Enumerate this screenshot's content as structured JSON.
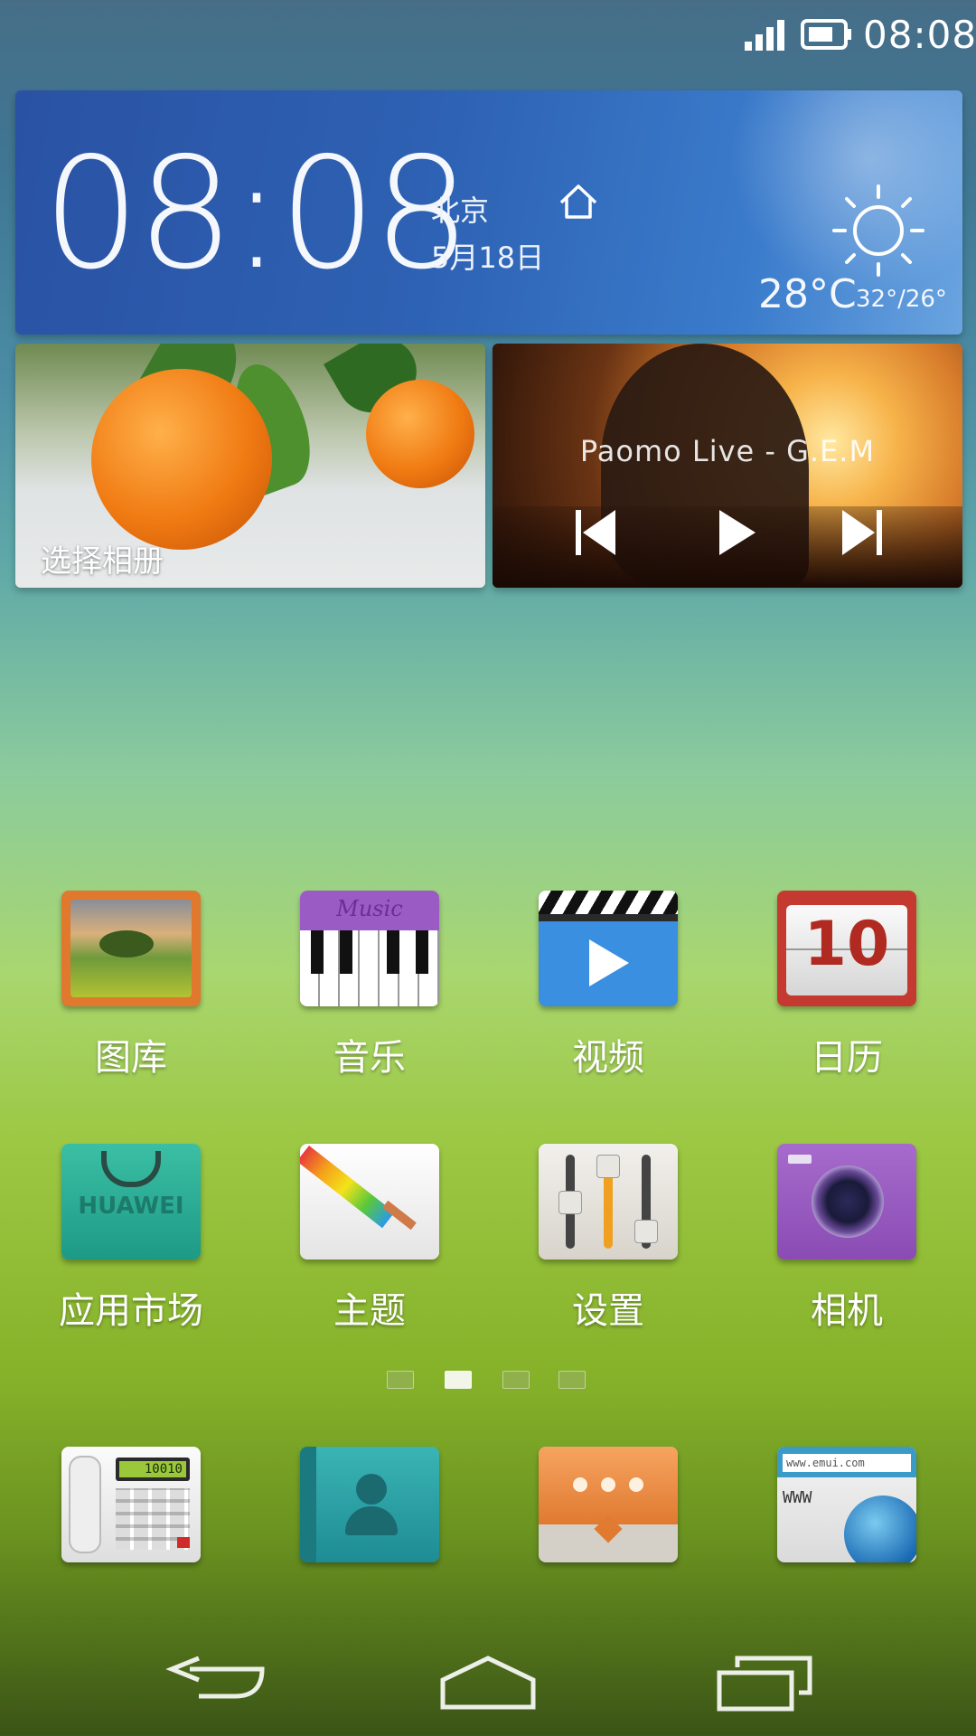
{
  "status_bar": {
    "time": "08:08"
  },
  "clock_widget": {
    "time": "08:08",
    "city": "北京",
    "date": "5月18日",
    "temperature": "28°C",
    "range": "32°/26°",
    "weather_icon": "sun-icon"
  },
  "photo_widget": {
    "label": "选择相册"
  },
  "music_widget": {
    "title": "Paomo Live - G.E.M"
  },
  "apps": [
    {
      "label": "图库",
      "icon": "gallery-icon"
    },
    {
      "label": "音乐",
      "icon": "music-icon",
      "icon_text": "Music"
    },
    {
      "label": "视频",
      "icon": "video-icon"
    },
    {
      "label": "日历",
      "icon": "calendar-icon",
      "icon_text": "10"
    },
    {
      "label": "应用市场",
      "icon": "app-market-icon",
      "icon_text": "HUAWEI"
    },
    {
      "label": "主题",
      "icon": "themes-icon"
    },
    {
      "label": "设置",
      "icon": "settings-icon"
    },
    {
      "label": "相机",
      "icon": "camera-icon"
    }
  ],
  "page_indicator": {
    "pages": 4,
    "active": 2
  },
  "dock": [
    {
      "icon": "phone-icon",
      "icon_text": "10010"
    },
    {
      "icon": "contacts-icon"
    },
    {
      "icon": "messages-icon"
    },
    {
      "icon": "browser-icon",
      "icon_text": "www.emui.com",
      "icon_text2": "WWW"
    }
  ],
  "colors": {
    "clock_widget": "#2e62b4",
    "accent_orange": "#f07a12",
    "active_dot": "#f2f6e8"
  }
}
